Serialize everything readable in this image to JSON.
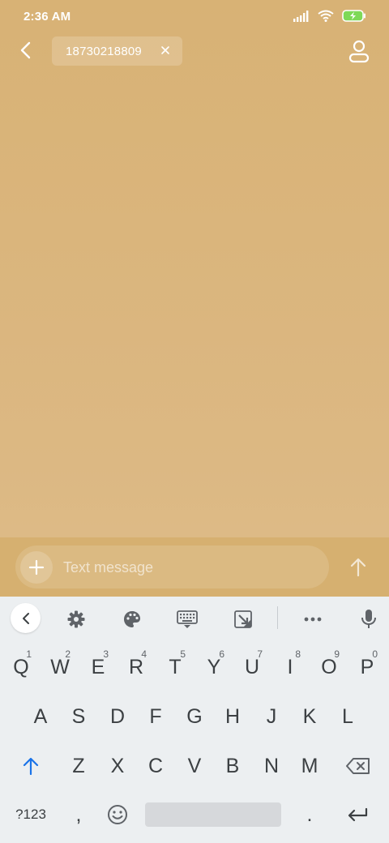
{
  "status_bar": {
    "time": "2:36 AM",
    "icons": [
      "signal-icon",
      "wifi-icon",
      "battery-charging-icon"
    ]
  },
  "header": {
    "recipient": "18730218809"
  },
  "compose": {
    "placeholder": "Text message"
  },
  "keyboard": {
    "row1": [
      {
        "key": "Q",
        "hint": "1"
      },
      {
        "key": "W",
        "hint": "2"
      },
      {
        "key": "E",
        "hint": "3"
      },
      {
        "key": "R",
        "hint": "4"
      },
      {
        "key": "T",
        "hint": "5"
      },
      {
        "key": "Y",
        "hint": "6"
      },
      {
        "key": "U",
        "hint": "7"
      },
      {
        "key": "I",
        "hint": "8"
      },
      {
        "key": "O",
        "hint": "9"
      },
      {
        "key": "P",
        "hint": "0"
      }
    ],
    "row2": [
      "A",
      "S",
      "D",
      "F",
      "G",
      "H",
      "J",
      "K",
      "L"
    ],
    "row3": [
      "Z",
      "X",
      "C",
      "V",
      "B",
      "N",
      "M"
    ],
    "symbols_label": "?123",
    "comma": ",",
    "period": "."
  },
  "colors": {
    "background": "#d8b275",
    "keyboard": "#eceff1",
    "accent": "#1a73e8"
  }
}
